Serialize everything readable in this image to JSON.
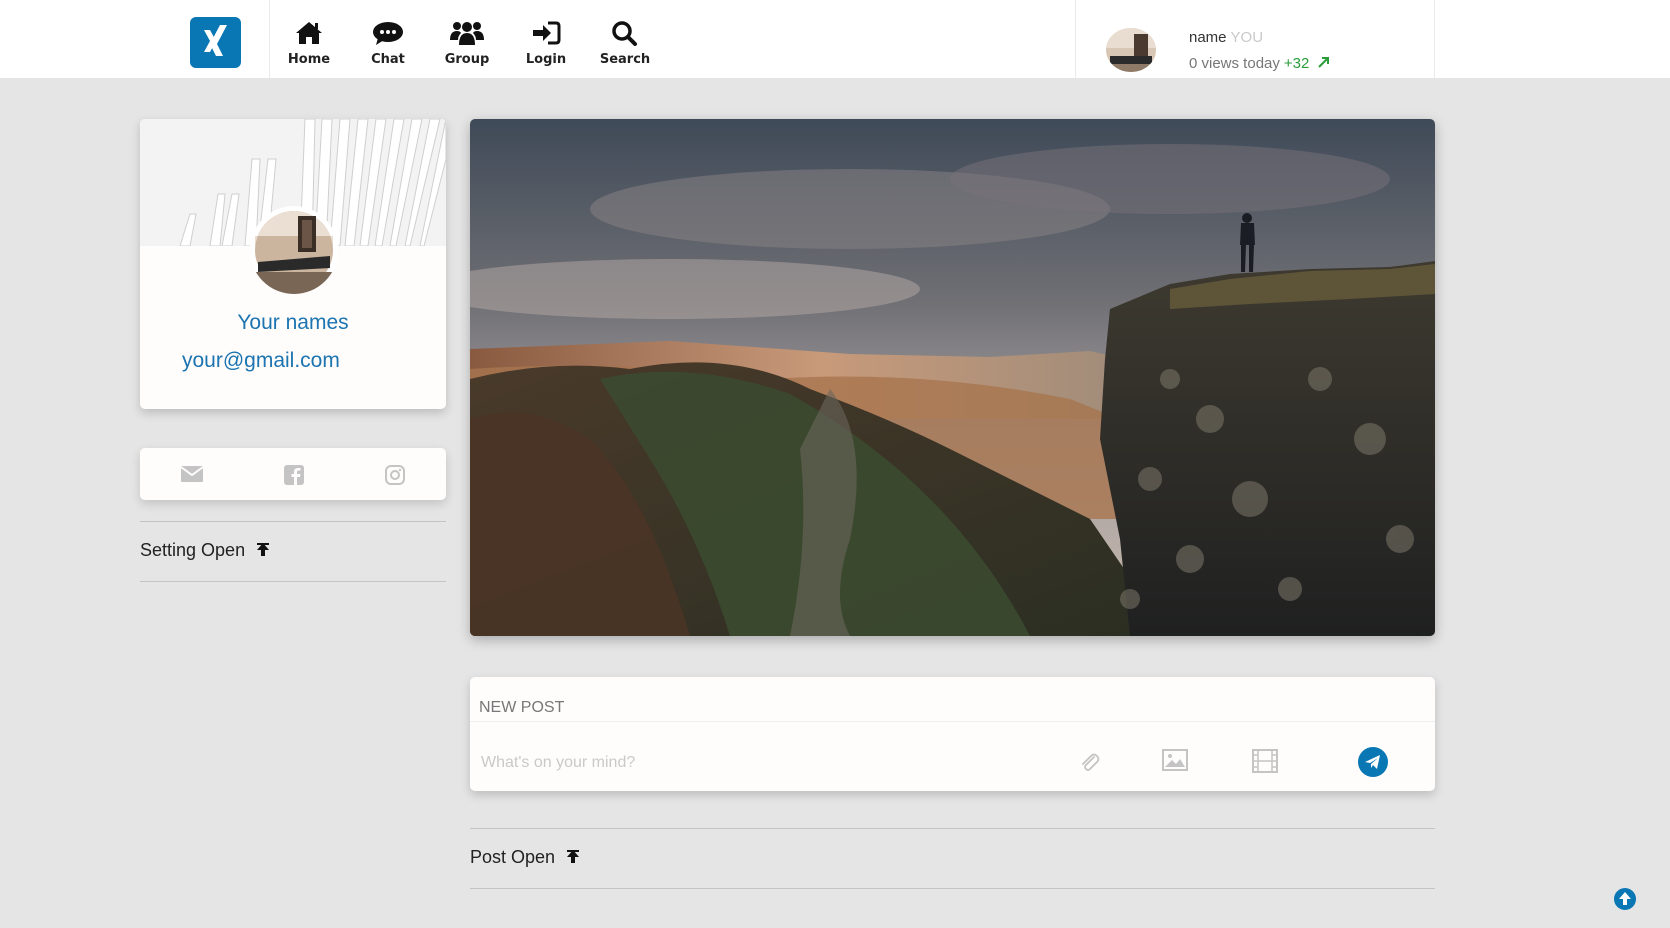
{
  "header": {
    "brand_color": "#0a77b5",
    "logo_icon": "xing-logo",
    "nav": [
      {
        "label": "Home",
        "icon": "home-icon"
      },
      {
        "label": "Chat",
        "icon": "chat-icon"
      },
      {
        "label": "Group",
        "icon": "group-icon"
      },
      {
        "label": "Login",
        "icon": "login-icon"
      },
      {
        "label": "Search",
        "icon": "search-icon"
      }
    ],
    "user": {
      "name": "name",
      "tag": "YOU",
      "views": "0 views today",
      "delta": "+32",
      "delta_icon": "arrow-up-right-icon",
      "delta_color": "#2a9d3a"
    }
  },
  "profile": {
    "name": "Your names",
    "email": "your@gmail.com",
    "link_color": "#1c74b0"
  },
  "social": [
    "envelope-icon",
    "facebook-icon",
    "instagram-icon"
  ],
  "settings": {
    "label": "Setting Open",
    "icon": "upload-arrow-icon"
  },
  "new_post": {
    "title": "NEW POST",
    "placeholder": "What's on your mind?",
    "tools": [
      "paperclip-icon",
      "image-icon",
      "film-icon",
      "send-icon"
    ]
  },
  "posts": {
    "label": "Post Open",
    "icon": "upload-arrow-icon"
  },
  "scroll_top_icon": "arrow-circle-up-icon"
}
